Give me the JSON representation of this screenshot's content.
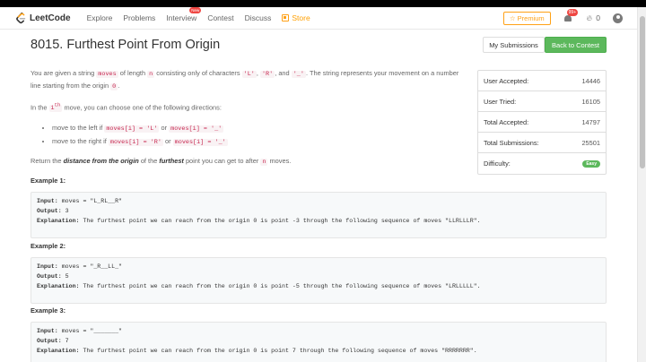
{
  "nav": {
    "logo_text": "LeetCode",
    "links": [
      "Explore",
      "Problems",
      "Interview",
      "Contest",
      "Discuss",
      "Store"
    ],
    "interview_badge": "New",
    "premium_label": "☆ Premium",
    "notif_count": "99+",
    "fire_count": "0"
  },
  "problem": {
    "title": "8015. Furthest Point From Origin",
    "my_submissions": "My Submissions",
    "back_to_contest": "Back to Contest"
  },
  "desc": {
    "p1_a": "You are given a string ",
    "p1_code1": "moves",
    "p1_b": " of length ",
    "p1_code2": "n",
    "p1_c": " consisting only of characters ",
    "p1_code3": "'L'",
    "p1_d": ", ",
    "p1_code4": "'R'",
    "p1_e": ", and ",
    "p1_code5": "'_'",
    "p1_f": ". The string represents your movement on a number line starting from the origin ",
    "p1_code6": "0",
    "p1_g": ".",
    "p2_a": "In the ",
    "p2_code": "i",
    "p2_sup": "th",
    "p2_b": " move, you can choose one of the following directions:",
    "li1_a": "move to the left if ",
    "li1_code1": "moves[i] = 'L'",
    "li1_b": " or ",
    "li1_code2": "moves[i] = '_'",
    "li2_a": "move to the right if ",
    "li2_code1": "moves[i] = 'R'",
    "li2_b": " or ",
    "li2_code2": "moves[i] = '_'",
    "p3_a": "Return the ",
    "p3_b1": "distance from the origin",
    "p3_c": " of the ",
    "p3_b2": "furthest",
    "p3_d": " point you can get to after ",
    "p3_code": "n",
    "p3_e": " moves."
  },
  "stats": [
    {
      "label": "User Accepted:",
      "value": "14446"
    },
    {
      "label": "User Tried:",
      "value": "16105"
    },
    {
      "label": "Total Accepted:",
      "value": "14797"
    },
    {
      "label": "Total Submissions:",
      "value": "25501"
    },
    {
      "label": "Difficulty:",
      "value": "Easy"
    }
  ],
  "examples": [
    {
      "head": "Example 1:",
      "input": "moves = \"L_RL__R\"",
      "output": "3",
      "explanation": "The furthest point we can reach from the origin 0 is point -3 through the following sequence of moves \"LLRLLLR\"."
    },
    {
      "head": "Example 2:",
      "input": "moves = \"_R__LL_\"",
      "output": "5",
      "explanation": "The furthest point we can reach from the origin 0 is point -5 through the following sequence of moves \"LRLLLLL\"."
    },
    {
      "head": "Example 3:",
      "input": "moves = \"_______\"",
      "output": "7",
      "explanation": "The furthest point we can reach from the origin 0 is point 7 through the following sequence of moves \"RRRRRRR\"."
    }
  ],
  "labels": {
    "input": "Input:",
    "output": "Output:",
    "explanation": "Explanation:"
  },
  "colors": {
    "accent": "#ffa116",
    "green": "#5cb85c",
    "badge_red": "#ef4743"
  }
}
